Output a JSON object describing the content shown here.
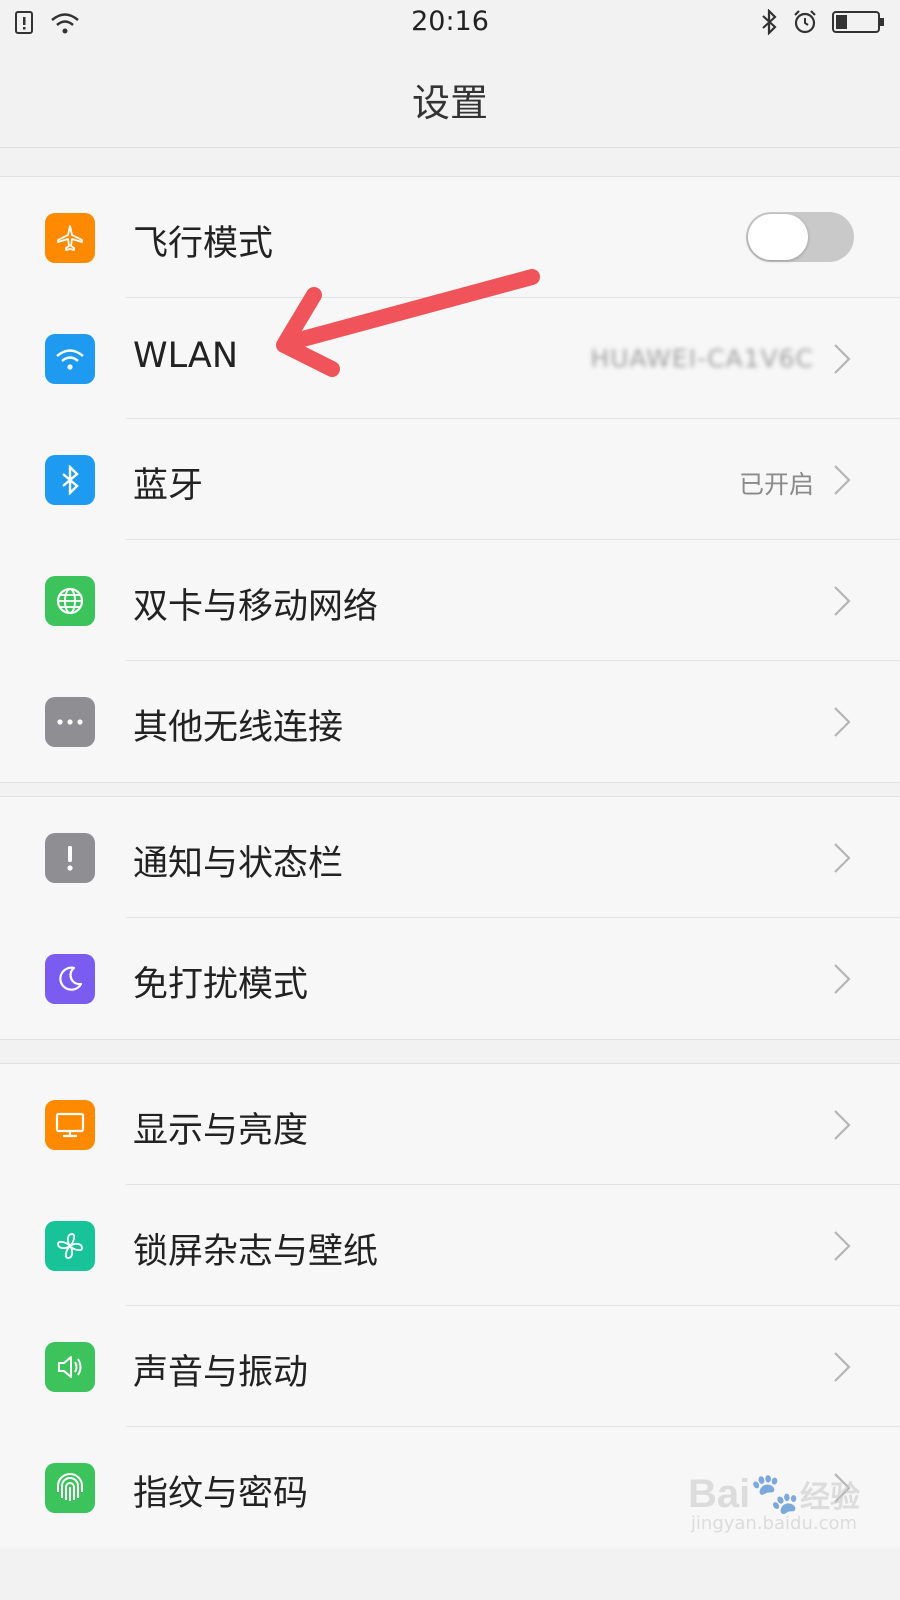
{
  "status_bar": {
    "time": "20:16",
    "icons_left": [
      "sim-alert-icon",
      "wifi-icon"
    ],
    "icons_right": [
      "bluetooth-icon",
      "alarm-icon",
      "battery-icon"
    ]
  },
  "header": {
    "title": "设置"
  },
  "groups": [
    {
      "rows": [
        {
          "label": "飞行模式",
          "icon": "airplane-icon",
          "color": "#ff8a00",
          "toggle": "off"
        },
        {
          "label": "WLAN",
          "icon": "wifi-icon",
          "color": "#1e9bf0",
          "value": "HUAWEI-CA1V6C"
        },
        {
          "label": "蓝牙",
          "icon": "bluetooth-icon",
          "color": "#1e9bf0",
          "value": "已开启"
        },
        {
          "label": "双卡与移动网络",
          "icon": "globe-icon",
          "color": "#3cc35c"
        },
        {
          "label": "其他无线连接",
          "icon": "more-icon",
          "color": "#8e8e93"
        }
      ]
    },
    {
      "rows": [
        {
          "label": "通知与状态栏",
          "icon": "exclamation-icon",
          "color": "#8e8e93"
        },
        {
          "label": "免打扰模式",
          "icon": "moon-icon",
          "color": "#7a5cf0"
        }
      ]
    },
    {
      "rows": [
        {
          "label": "显示与亮度",
          "icon": "monitor-icon",
          "color": "#ff8a00"
        },
        {
          "label": "锁屏杂志与壁纸",
          "icon": "pinwheel-icon",
          "color": "#19c39a"
        },
        {
          "label": "声音与振动",
          "icon": "speaker-icon",
          "color": "#3cc35c"
        },
        {
          "label": "指纹与密码",
          "icon": "fingerprint-icon",
          "color": "#3cc35c"
        }
      ]
    }
  ],
  "watermark": {
    "brand": "Bai",
    "brand_zh": "经验",
    "url": "jingyan.baidu.com"
  },
  "annotation": {
    "arrow_color": "#f0545a"
  }
}
